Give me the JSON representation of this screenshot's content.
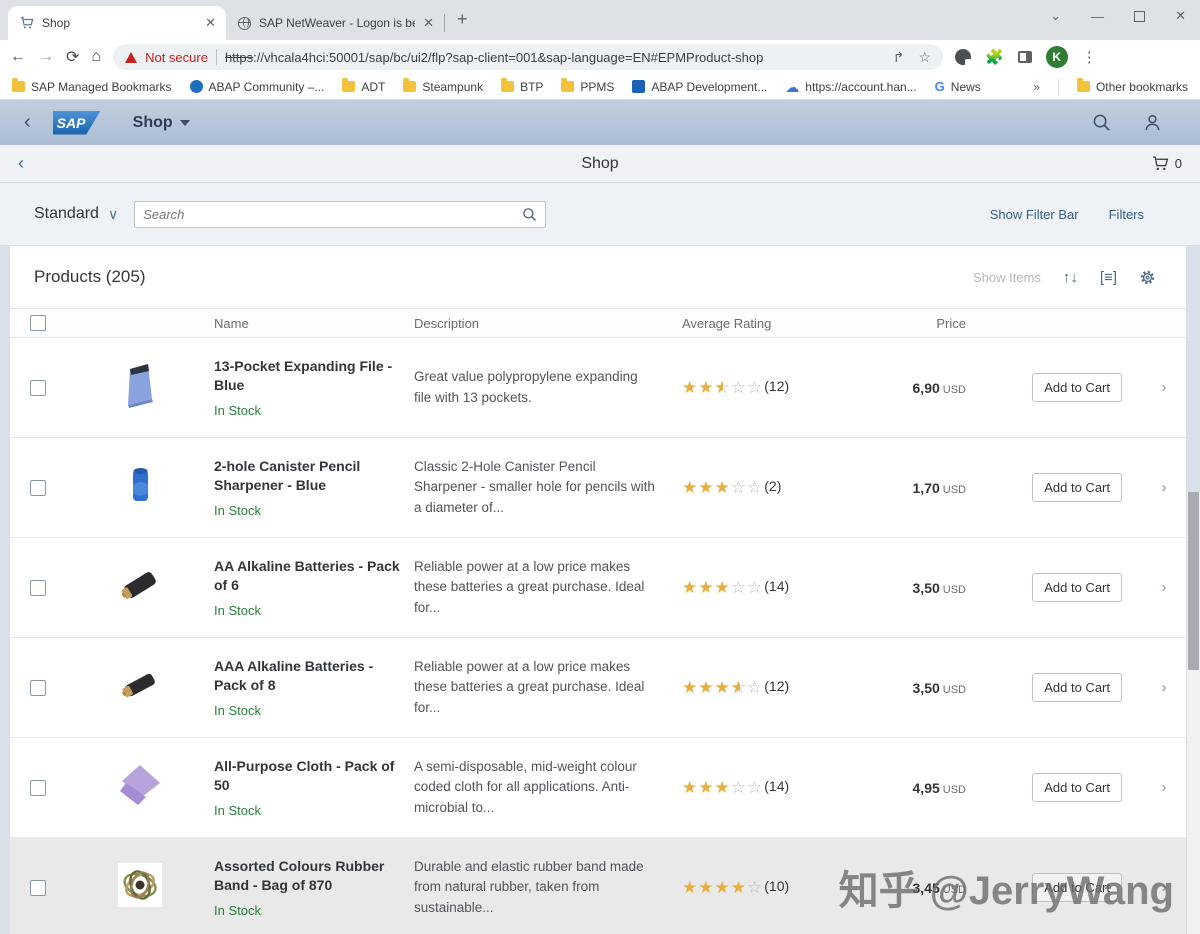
{
  "browser": {
    "tabs": [
      {
        "title": "Shop",
        "icon": "cart-icon"
      },
      {
        "title": "SAP NetWeaver - Logon is being",
        "icon": "globe-icon"
      }
    ],
    "address": {
      "security_label": "Not secure",
      "scheme": "https",
      "url_rest": "://vhcala4hci:50001/sap/bc/ui2/flp?sap-client=001&sap-language=EN#EPMProduct-shop"
    },
    "bookmarks": [
      {
        "label": "SAP Managed Bookmarks",
        "icon": "folder-icon"
      },
      {
        "label": "ABAP Community –...",
        "icon": "community-badge-icon"
      },
      {
        "label": "ADT",
        "icon": "folder-icon"
      },
      {
        "label": "Steampunk",
        "icon": "folder-icon"
      },
      {
        "label": "BTP",
        "icon": "folder-icon"
      },
      {
        "label": "PPMS",
        "icon": "folder-icon"
      },
      {
        "label": "ABAP Development...",
        "icon": "site-icon"
      },
      {
        "label": "https://account.han...",
        "icon": "cloud-icon"
      },
      {
        "label": "News",
        "icon": "google-g-icon"
      }
    ],
    "other_bookmarks_label": "Other bookmarks",
    "avatar_letter": "K"
  },
  "shell": {
    "app_title": "Shop"
  },
  "page": {
    "title": "Shop",
    "cart_count": "0"
  },
  "filterbar": {
    "variant_label": "Standard",
    "search_placeholder": "Search",
    "show_filter_bar_label": "Show Filter Bar",
    "filters_label": "Filters"
  },
  "products": {
    "header": "Products (205)",
    "show_items_label": "Show Items",
    "columns": {
      "name": "Name",
      "description": "Description",
      "rating": "Average Rating",
      "price": "Price"
    },
    "add_to_cart_label": "Add to Cart",
    "items": [
      {
        "name": "13-Pocket Expanding File - Blue",
        "stock": "In Stock",
        "description": "Great value polypropylene expanding file with 13 pockets.",
        "rating": 2.5,
        "rating_count": "(12)",
        "price": "6,90",
        "currency": "USD",
        "image": "expanding-file"
      },
      {
        "name": "2-hole Canister Pencil Sharpener - Blue",
        "stock": "In Stock",
        "description": "Classic 2-Hole Canister Pencil Sharpener - smaller hole for pencils with a diameter of...",
        "rating": 3,
        "rating_count": "(2)",
        "price": "1,70",
        "currency": "USD",
        "image": "sharpener"
      },
      {
        "name": "AA Alkaline Batteries - Pack of 6",
        "stock": "In Stock",
        "description": "Reliable power at a low price makes these batteries a great purchase. Ideal for...",
        "rating": 3,
        "rating_count": "(14)",
        "price": "3,50",
        "currency": "USD",
        "image": "battery-aa"
      },
      {
        "name": "AAA Alkaline Batteries - Pack of 8",
        "stock": "In Stock",
        "description": "Reliable power at a low price makes these batteries a great purchase. Ideal for...",
        "rating": 3.5,
        "rating_count": "(12)",
        "price": "3,50",
        "currency": "USD",
        "image": "battery-aaa"
      },
      {
        "name": "All-Purpose Cloth - Pack of 50",
        "stock": "In Stock",
        "description": "A semi-disposable, mid-weight colour coded cloth for all applications. Anti-microbial to...",
        "rating": 3,
        "rating_count": "(14)",
        "price": "4,95",
        "currency": "USD",
        "image": "cloth"
      },
      {
        "name": "Assorted Colours Rubber Band - Bag of 870",
        "stock": "In Stock",
        "description": "Durable and elastic rubber band made from natural rubber, taken from sustainable...",
        "rating": 4,
        "rating_count": "(10)",
        "price": "3,45",
        "currency": "USD",
        "image": "rubber-bands"
      }
    ]
  },
  "watermark": "知乎 @JerryWang",
  "colors": {
    "star_gold": "#e7ae3c",
    "stock_green": "#2b7d3c",
    "link_blue": "#346187",
    "not_secure_red": "#c5221f",
    "avatar_green": "#2e7d32",
    "shell_top": "#c3cfdf",
    "shell_bottom": "#abbcd4"
  }
}
